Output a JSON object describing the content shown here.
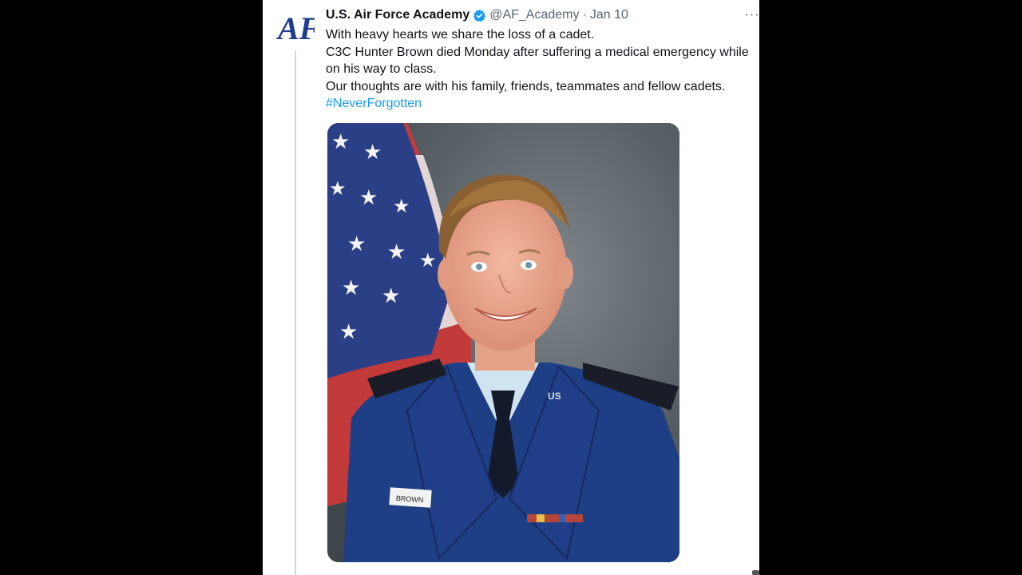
{
  "tweet": {
    "display_name": "U.S. Air Force Academy",
    "handle": "@AF_Academy",
    "separator": "·",
    "date": "Jan 10",
    "more_label": "···",
    "text_lines": [
      "With heavy hearts we share the loss of a cadet.",
      "C3C Hunter Brown died Monday after suffering a medical emergency while on his way to class.",
      "Our thoughts are with his family, friends, teammates and fellow cadets."
    ],
    "hashtag": "#NeverForgotten",
    "avatar_logo": "AF",
    "photo": {
      "name_tag": "BROWN",
      "collar_insignia": "US"
    }
  },
  "colors": {
    "page_bg": "#000000",
    "panel_bg": "#ffffff",
    "text": "#0f1419",
    "muted": "#536471",
    "link": "#1d9bf0",
    "verified": "#1d9bf0",
    "logo": "#1f3d8f",
    "uniform": "#1e3e85"
  },
  "icons": {
    "verified": "verified-badge-icon",
    "more": "more-options-icon"
  }
}
